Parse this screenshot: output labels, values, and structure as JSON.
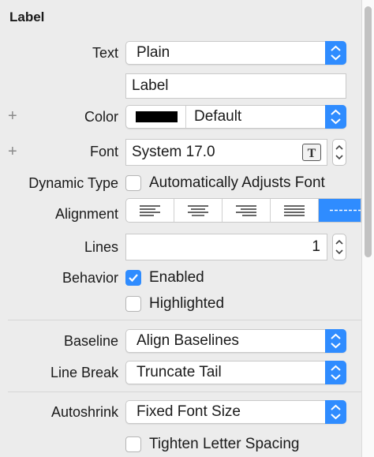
{
  "section": {
    "title": "Label"
  },
  "text_row": {
    "label": "Text",
    "value": "Plain"
  },
  "text_field": {
    "value": "Label"
  },
  "color_row": {
    "label": "Color",
    "swatch_color": "#000000",
    "value": "Default"
  },
  "font_row": {
    "label": "Font",
    "value": "System 17.0"
  },
  "dynamic_type": {
    "label": "Dynamic Type",
    "checkbox_label": "Automatically Adjusts Font",
    "checked": false
  },
  "alignment": {
    "label": "Alignment",
    "options": [
      "left",
      "center",
      "right",
      "justified",
      "natural"
    ],
    "selected": "natural"
  },
  "lines": {
    "label": "Lines",
    "value": "1"
  },
  "behavior": {
    "label": "Behavior",
    "enabled_label": "Enabled",
    "enabled_checked": true,
    "highlighted_label": "Highlighted",
    "highlighted_checked": false
  },
  "baseline": {
    "label": "Baseline",
    "value": "Align Baselines"
  },
  "line_break": {
    "label": "Line Break",
    "value": "Truncate Tail"
  },
  "autoshrink": {
    "label": "Autoshrink",
    "value": "Fixed Font Size"
  },
  "tighten": {
    "label": "Tighten Letter Spacing",
    "checked": false
  },
  "colors": {
    "accent": "#2f8cff"
  }
}
